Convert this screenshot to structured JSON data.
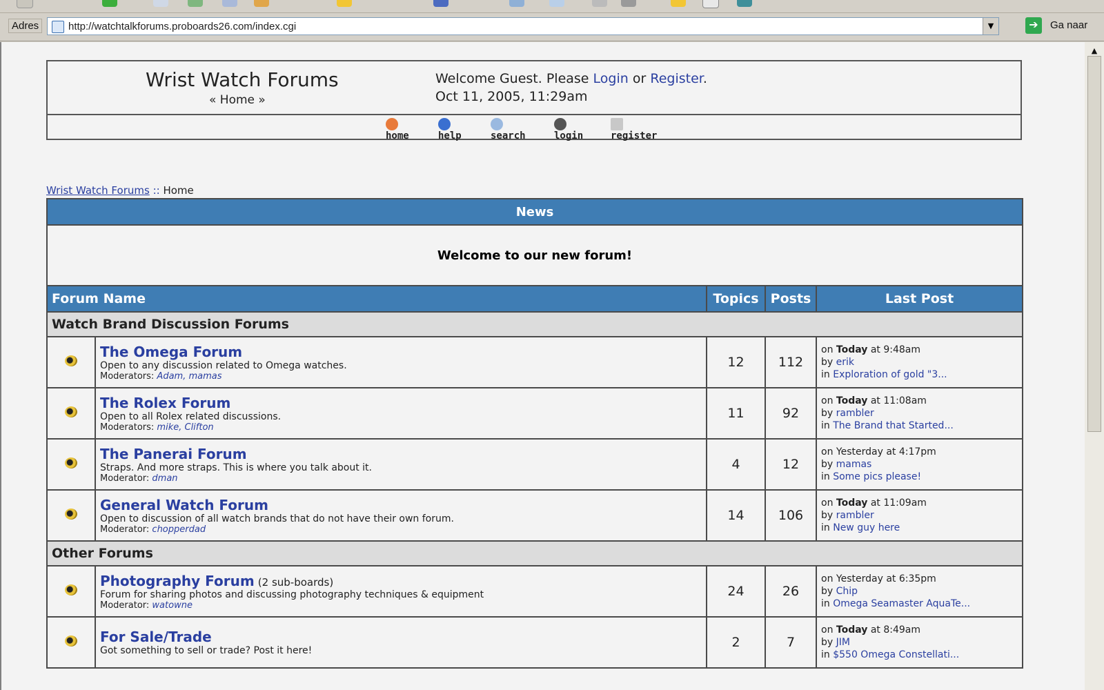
{
  "browser": {
    "address_label": "Adres",
    "url": "http://watchtalkforums.proboards26.com/index.cgi",
    "go_label": "Ga naar"
  },
  "header": {
    "site_title": "Wrist Watch Forums",
    "home_crumb": "« Home »",
    "welcome_prefix": "Welcome Guest. Please",
    "login": "Login",
    "or": "or",
    "register": "Register",
    "date": "Oct 11, 2005, 11:29am",
    "nav": [
      "home",
      "help",
      "search",
      "login",
      "register"
    ]
  },
  "breadcrumb": {
    "root": "Wrist Watch Forums",
    "sep": "::",
    "current": "Home"
  },
  "news": {
    "title": "News",
    "body": "Welcome to our new forum!"
  },
  "columns": {
    "name": "Forum Name",
    "topics": "Topics",
    "posts": "Posts",
    "last": "Last Post"
  },
  "categories": [
    {
      "title": "Watch Brand Discussion Forums",
      "forums": [
        {
          "name": "The Omega Forum",
          "desc": "Open to any discussion related to Omega watches.",
          "mod_label": "Moderators:",
          "mods": "Adam, mamas",
          "topics": "12",
          "posts": "112",
          "last_on": "on",
          "last_when": "Today",
          "last_time": "at 9:48am",
          "last_by": "by",
          "last_user": "erik",
          "last_in": "in",
          "last_thread": "Exploration of gold \"3..."
        },
        {
          "name": "The Rolex Forum",
          "desc": "Open to all Rolex related discussions.",
          "mod_label": "Moderators:",
          "mods": "mike, Clifton",
          "topics": "11",
          "posts": "92",
          "last_on": "on",
          "last_when": "Today",
          "last_time": "at 11:08am",
          "last_by": "by",
          "last_user": "rambler",
          "last_in": "in",
          "last_thread": "The Brand that Started..."
        },
        {
          "name": "The Panerai Forum",
          "desc": "Straps. And more straps. This is where you talk about it.",
          "mod_label": "Moderator:",
          "mods": "dman",
          "topics": "4",
          "posts": "12",
          "last_on": "on",
          "last_when": "Yesterday",
          "last_time": "at 4:17pm",
          "last_by": "by",
          "last_user": "mamas",
          "last_in": "in",
          "last_thread": "Some pics please!"
        },
        {
          "name": "General Watch Forum",
          "desc": "Open to discussion of all watch brands that do not have their own forum.",
          "mod_label": "Moderator:",
          "mods": "chopperdad",
          "topics": "14",
          "posts": "106",
          "last_on": "on",
          "last_when": "Today",
          "last_time": "at 11:09am",
          "last_by": "by",
          "last_user": "rambler",
          "last_in": "in",
          "last_thread": "New guy here"
        }
      ]
    },
    {
      "title": "Other Forums",
      "forums": [
        {
          "name": "Photography Forum",
          "sub": "(2 sub-boards)",
          "desc": "Forum for sharing photos and discussing photography techniques & equipment",
          "mod_label": "Moderator:",
          "mods": "watowne",
          "topics": "24",
          "posts": "26",
          "last_on": "on",
          "last_when": "Yesterday",
          "last_time": "at 6:35pm",
          "last_by": "by",
          "last_user": "Chip",
          "last_in": "in",
          "last_thread": "Omega Seamaster AquaTe..."
        },
        {
          "name": "For Sale/Trade",
          "desc": "Got something to sell or trade? Post it here!",
          "topics": "2",
          "posts": "7",
          "last_on": "on",
          "last_when": "Today",
          "last_time": "at 8:49am",
          "last_by": "by",
          "last_user": "JIM",
          "last_in": "in",
          "last_thread": "$550 Omega Constellati..."
        }
      ]
    }
  ]
}
